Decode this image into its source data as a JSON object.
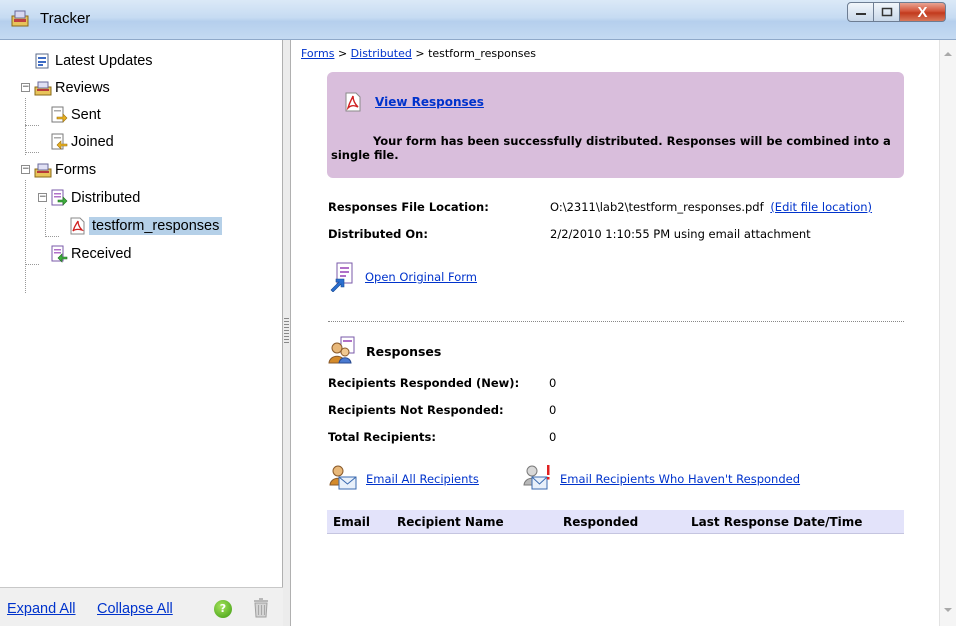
{
  "window": {
    "title": "Tracker",
    "close_glyph": "X"
  },
  "tree": {
    "items": [
      {
        "label": "Latest Updates",
        "icon": "updates-icon"
      },
      {
        "label": "Reviews",
        "icon": "reviews-folder-icon",
        "expander": "−"
      },
      {
        "label": "Sent",
        "icon": "sent-icon"
      },
      {
        "label": "Joined",
        "icon": "joined-icon"
      },
      {
        "label": "Forms",
        "icon": "forms-folder-icon",
        "expander": "−"
      },
      {
        "label": "Distributed",
        "icon": "distributed-icon",
        "expander": "−"
      },
      {
        "label": "testform_responses",
        "icon": "pdf-file-icon",
        "selected": true
      },
      {
        "label": "Received",
        "icon": "received-icon"
      }
    ]
  },
  "footer": {
    "expand_all": "Expand All",
    "collapse_all": "Collapse All",
    "help_glyph": "?"
  },
  "breadcrumb": {
    "forms": "Forms",
    "sep1": " > ",
    "distributed": "Distributed",
    "sep2": " > ",
    "current": "testform_responses"
  },
  "banner": {
    "view_responses": "View Responses",
    "message": "Your form has been successfully distributed. Responses will be combined into a single file."
  },
  "details": {
    "location_label": "Responses File Location:",
    "location_value": "O:\\2311\\lab2\\testform_responses.pdf",
    "edit_location": "(Edit file location)",
    "distributed_label": "Distributed On:",
    "distributed_value": "2/2/2010 1:10:55 PM using email attachment",
    "open_original": "Open Original Form"
  },
  "responses": {
    "title": "Responses",
    "stats": [
      {
        "label": "Recipients Responded (New):",
        "value": "0"
      },
      {
        "label": "Recipients Not Responded:",
        "value": "0"
      },
      {
        "label": "Total Recipients:",
        "value": "0"
      }
    ],
    "email_all": "Email All Recipients",
    "email_not_responded": "Email Recipients Who Haven't Responded"
  },
  "table": {
    "columns": [
      "Email",
      "Recipient Name",
      "Responded",
      "Last Response Date/Time"
    ]
  },
  "colors": {
    "banner_bg": "#d9bedc",
    "link": "#0033cc",
    "selection": "#b5d0e8",
    "table_header": "#e3e3fa"
  }
}
